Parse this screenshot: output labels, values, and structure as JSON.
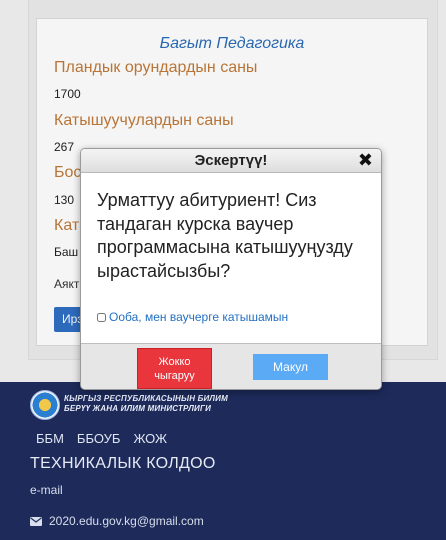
{
  "program_card": {
    "title": "Багыт Педагогика",
    "fields": [
      {
        "label": "Пландык орундардын саны",
        "value": "1700"
      },
      {
        "label": "Катышуучулардын саны",
        "value": "267"
      },
      {
        "label": "Бос",
        "value": "130"
      },
      {
        "label": "Кат",
        "value": "Баш"
      }
    ],
    "trailing_text": "Аякт",
    "apply_button_label": "Ирэ"
  },
  "modal": {
    "title": "Эскертүү!",
    "close_symbol": "✖",
    "message": "Урматтуу абитуриент! Сиз тандаган курска ваучер программасына катышууңузду ырастайсызбы?",
    "agree_checkbox_label": "Ооба, мен ваучерге катышамын",
    "agree_checked": false,
    "cancel_button_label": "Жокко чыгаруу",
    "ok_button_label": "Макул"
  },
  "footer": {
    "ministry_name_line1": "КЫРГЫЗ РЕСПУБЛИКАСЫНЫН БИЛИМ",
    "ministry_name_line2": "БЕРҮҮ ЖАНА ИЛИМ МИНИСТРЛИГИ",
    "links": [
      "ББМ",
      "ББОУБ",
      "ЖОЖ"
    ],
    "support_title": "ТЕХНИКАЛЫК КОЛДОО",
    "email_label": "e-mail",
    "email_value": "2020.edu.gov.kg@gmail.com",
    "email_icon": "envelope-icon"
  },
  "colors": {
    "footer_bg": "#1d2a5a",
    "cancel_red": "#e8363c",
    "ok_blue": "#5aaaf5",
    "card_title_blue": "#2a6db8",
    "field_label_orange": "#c07a3a"
  }
}
